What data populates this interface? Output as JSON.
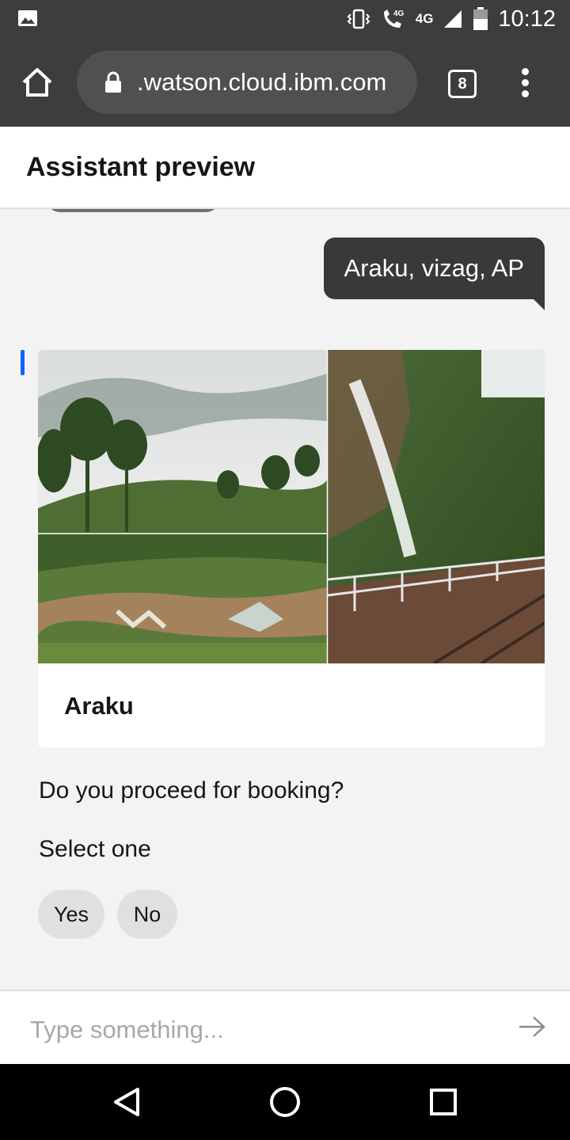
{
  "status_bar": {
    "time": "10:12",
    "network": "4G",
    "volte": "4G",
    "icons": [
      "gallery-icon",
      "vibrate-icon",
      "volte-call-icon",
      "signal-icon",
      "battery-icon"
    ]
  },
  "browser": {
    "url": ".watson.cloud.ibm.com",
    "tab_count": "8",
    "icons": [
      "home-icon",
      "lock-icon",
      "overflow-menu-icon"
    ]
  },
  "header": {
    "title": "Assistant preview"
  },
  "chat": {
    "user_message": "Araku, vizag, AP",
    "card": {
      "title": "Araku",
      "image_desc": "photo-collage"
    },
    "question": "Do you proceed for booking?",
    "select_label": "Select one",
    "options": [
      "Yes",
      "No"
    ]
  },
  "input": {
    "placeholder": "Type something...",
    "send_icon": "arrow-right-icon"
  },
  "nav_bar": {
    "icons": [
      "back-icon",
      "home-circle-icon",
      "recents-icon"
    ]
  },
  "colors": {
    "chrome": "#3b3d3f",
    "user_bubble": "#393939",
    "accent": "#0f62fe",
    "chip": "#e0e0e0"
  }
}
